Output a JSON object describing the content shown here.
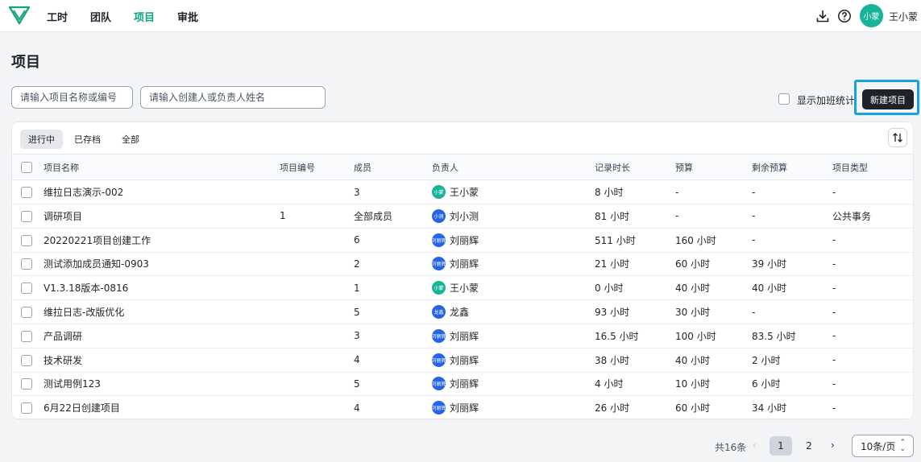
{
  "nav": {
    "items": [
      {
        "label": "工时",
        "active": false
      },
      {
        "label": "团队",
        "active": false
      },
      {
        "label": "项目",
        "active": true
      },
      {
        "label": "审批",
        "active": false
      }
    ],
    "user": {
      "avatar_text": "小蒙",
      "name": "王小蒙"
    },
    "icons": [
      "download-icon",
      "help-icon"
    ]
  },
  "page": {
    "title": "项目"
  },
  "filters": {
    "project_placeholder": "请输入项目名称或编号",
    "person_placeholder": "请输入创建人或负责人姓名",
    "overtime_label": "显示加班统计",
    "new_button": "新建项目"
  },
  "tabs": [
    {
      "label": "进行中",
      "active": true
    },
    {
      "label": "已存档",
      "active": false
    },
    {
      "label": "全部",
      "active": false
    }
  ],
  "table": {
    "headers": [
      "项目名称",
      "项目编号",
      "成员",
      "负责人",
      "记录时长",
      "预算",
      "剩余预算",
      "项目类型"
    ],
    "rows": [
      {
        "name": "维拉日志演示-002",
        "code": "",
        "members": "3",
        "owner": "王小蒙",
        "owner_avatar": "小蒙",
        "owner_color": "#17b39a",
        "duration": "8 小时",
        "budget": "-",
        "remaining": "-",
        "type": "-"
      },
      {
        "name": "调研项目",
        "code": "1",
        "members": "全部成员",
        "owner": "刘小测",
        "owner_avatar": "小测",
        "owner_color": "#2563eb",
        "duration": "81 小时",
        "budget": "-",
        "remaining": "-",
        "type": "公共事务"
      },
      {
        "name": "20220221项目创建工作",
        "code": "",
        "members": "6",
        "owner": "刘丽辉",
        "owner_avatar": "刘丽辉",
        "owner_color": "#2563eb",
        "duration": "511 小时",
        "budget": "160 小时",
        "remaining": "-",
        "type": "-"
      },
      {
        "name": "测试添加成员通知-0903",
        "code": "",
        "members": "2",
        "owner": "刘丽辉",
        "owner_avatar": "刘丽辉",
        "owner_color": "#2563eb",
        "duration": "21 小时",
        "budget": "60 小时",
        "remaining": "39 小时",
        "type": "-"
      },
      {
        "name": "V1.3.18版本-0816",
        "code": "",
        "members": "1",
        "owner": "王小蒙",
        "owner_avatar": "小蒙",
        "owner_color": "#17b39a",
        "duration": "0 小时",
        "budget": "40 小时",
        "remaining": "40 小时",
        "type": "-"
      },
      {
        "name": "维拉日志-改版优化",
        "code": "",
        "members": "5",
        "owner": "龙鑫",
        "owner_avatar": "龙鑫",
        "owner_color": "#2563eb",
        "duration": "93 小时",
        "budget": "30 小时",
        "remaining": "-",
        "type": "-"
      },
      {
        "name": "产品调研",
        "code": "",
        "members": "3",
        "owner": "刘丽辉",
        "owner_avatar": "刘丽辉",
        "owner_color": "#2563eb",
        "duration": "16.5 小时",
        "budget": "100 小时",
        "remaining": "83.5 小时",
        "type": "-"
      },
      {
        "name": "技术研发",
        "code": "",
        "members": "4",
        "owner": "刘丽辉",
        "owner_avatar": "刘丽辉",
        "owner_color": "#2563eb",
        "duration": "38 小时",
        "budget": "40 小时",
        "remaining": "2 小时",
        "type": "-"
      },
      {
        "name": "测试用例123",
        "code": "",
        "members": "5",
        "owner": "刘丽辉",
        "owner_avatar": "刘丽辉",
        "owner_color": "#2563eb",
        "duration": "4 小时",
        "budget": "10 小时",
        "remaining": "6 小时",
        "type": "-"
      },
      {
        "name": "6月22日创建项目",
        "code": "",
        "members": "4",
        "owner": "刘丽辉",
        "owner_avatar": "刘丽辉",
        "owner_color": "#2563eb",
        "duration": "26 小时",
        "budget": "60 小时",
        "remaining": "34 小时",
        "type": "-"
      }
    ]
  },
  "pagination": {
    "total": "共16条",
    "pages": [
      {
        "label": "1",
        "active": true
      },
      {
        "label": "2",
        "active": false
      }
    ],
    "page_size": "10条/页"
  },
  "colors": {
    "accent": "#10a37f",
    "highlight": "#14a3e5",
    "primary_button": "#1f2329"
  }
}
